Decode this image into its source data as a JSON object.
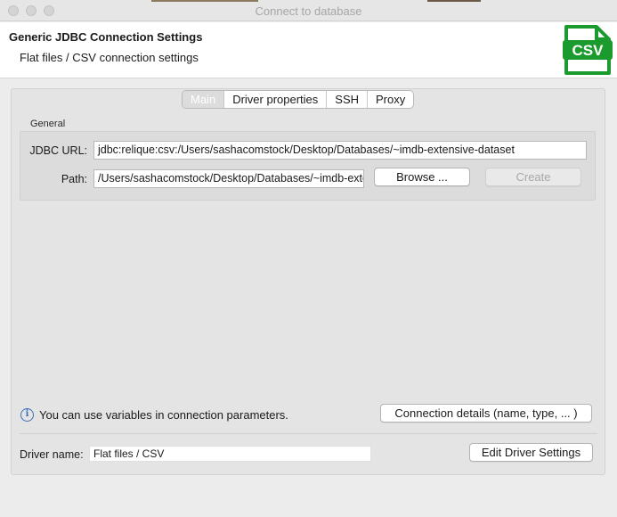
{
  "window": {
    "title": "Connect to database"
  },
  "header": {
    "title": "Generic JDBC Connection Settings",
    "subtitle": "Flat files / CSV connection settings",
    "logo_text": "CSV",
    "logo_color": "#1b9a2e"
  },
  "tabs": [
    {
      "label": "Main",
      "active": true
    },
    {
      "label": "Driver properties",
      "active": false
    },
    {
      "label": "SSH",
      "active": false
    },
    {
      "label": "Proxy",
      "active": false
    }
  ],
  "general": {
    "group_label": "General",
    "jdbc_url_label": "JDBC URL:",
    "jdbc_url_value": "jdbc:relique:csv:/Users/sashacomstock/Desktop/Databases/~imdb-extensive-dataset",
    "path_label": "Path:",
    "path_value": "/Users/sashacomstock/Desktop/Databases/~imdb-extensive-dataset",
    "browse_label": "Browse ...",
    "create_label": "Create"
  },
  "info": {
    "icon": "info-icon",
    "text": "You can use variables in connection parameters."
  },
  "connection_details_label": "Connection details (name, type, ... )",
  "driver": {
    "label": "Driver name:",
    "value": "Flat files / CSV",
    "edit_label": "Edit Driver Settings"
  }
}
